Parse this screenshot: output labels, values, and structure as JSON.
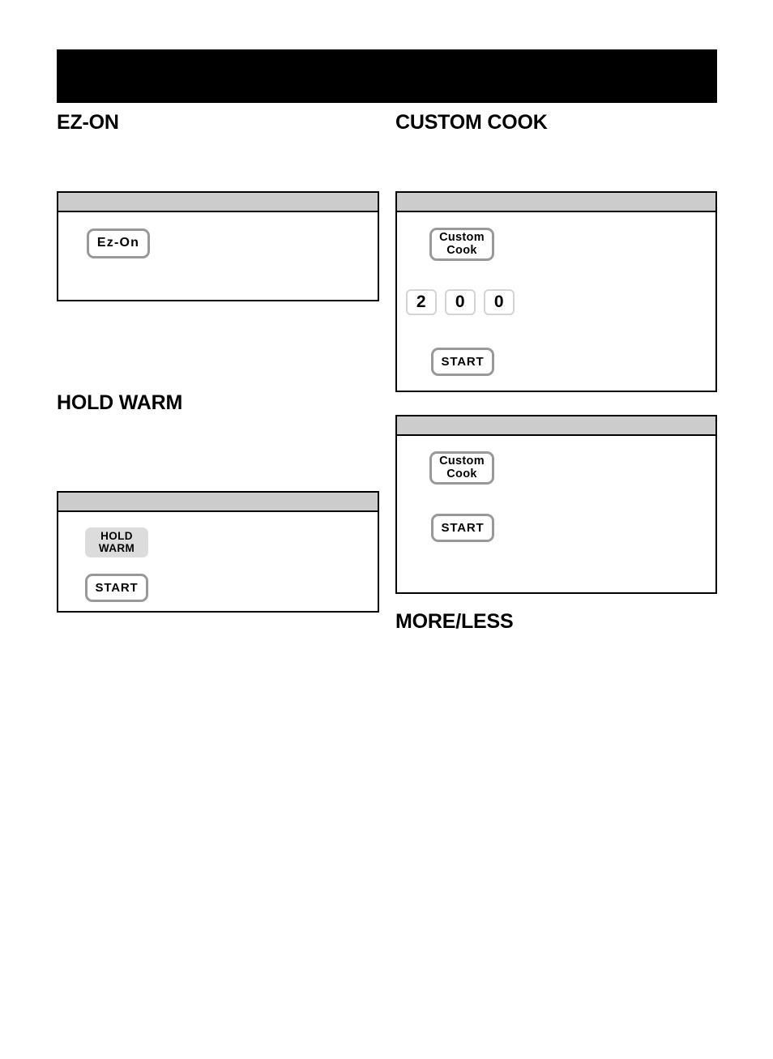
{
  "page": {
    "header_bar": {
      "label": "",
      "color": "#000000"
    }
  },
  "colors": {
    "panel_border": "#000000",
    "panel_strip": "#cccccc",
    "key_border": "#999999",
    "key_filled": "#dcdcdc",
    "digit_border": "#d4d4d4",
    "text": "#000000"
  },
  "sections": {
    "ez_on": {
      "title": "EZ-ON",
      "panel": {
        "keys": [
          {
            "name": "ez-on",
            "label": "Ez-On",
            "style": "outline"
          }
        ]
      }
    },
    "hold_warm": {
      "title": "HOLD WARM",
      "panel": {
        "keys": [
          {
            "name": "hold-warm",
            "line1": "HOLD",
            "line2": "WARM",
            "style": "filled"
          },
          {
            "name": "start",
            "label": "START",
            "style": "outline"
          }
        ]
      }
    },
    "custom_cook": {
      "title": "CUSTOM COOK",
      "panel_1": {
        "keys": [
          {
            "name": "custom-cook",
            "line1": "Custom",
            "line2": "Cook",
            "style": "outline"
          },
          {
            "name": "start",
            "label": "START",
            "style": "outline"
          }
        ],
        "digits": [
          "2",
          "0",
          "0"
        ]
      },
      "panel_2": {
        "keys": [
          {
            "name": "custom-cook",
            "line1": "Custom",
            "line2": "Cook",
            "style": "outline"
          },
          {
            "name": "start",
            "label": "START",
            "style": "outline"
          }
        ]
      }
    },
    "more_less": {
      "title": "MORE/LESS"
    }
  }
}
